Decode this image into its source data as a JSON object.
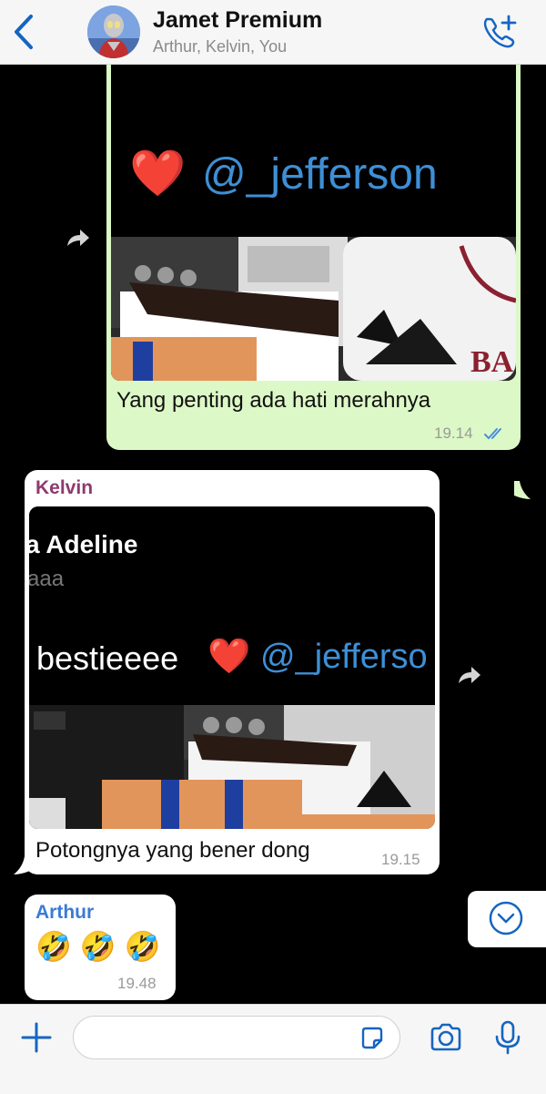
{
  "header": {
    "title": "Jamet Premium",
    "subtitle": "Arthur, Kelvin, You"
  },
  "messages": [
    {
      "direction": "outgoing",
      "media_overlay": {
        "mention": "@_jefferson",
        "emoji": "❤️"
      },
      "text": "Yang penting ada hati merahnya",
      "time": "19.14",
      "status": "read"
    },
    {
      "direction": "incoming",
      "sender": "Kelvin",
      "media_overlay": {
        "name": "a Adeline",
        "sub": "aaa",
        "caption": "bestieeee",
        "emoji": "❤️",
        "mention": "@_jefferso"
      },
      "text": "Potongnya yang bener dong",
      "time": "19.15"
    },
    {
      "direction": "incoming",
      "sender": "Arthur",
      "emojis": "🤣 🤣 🤣",
      "time": "19.48"
    }
  ],
  "input": {
    "placeholder": ""
  },
  "icons": {
    "back": "chevron-left-icon",
    "call": "phone-plus-icon",
    "forward": "forward-arrow-icon",
    "scroll_down": "chevron-down-circle-icon",
    "attach": "plus-icon",
    "sticker": "sticker-icon",
    "camera": "camera-icon",
    "mic": "microphone-icon"
  },
  "colors": {
    "accent": "#1565c0",
    "outgoing_bubble": "#dcf8c6",
    "incoming_bubble": "#ffffff",
    "kelvin_name": "#8e3a6e",
    "arthur_name": "#3a7bd5",
    "read_ticks": "#4a8fd8",
    "mention": "#3e8fd6"
  }
}
